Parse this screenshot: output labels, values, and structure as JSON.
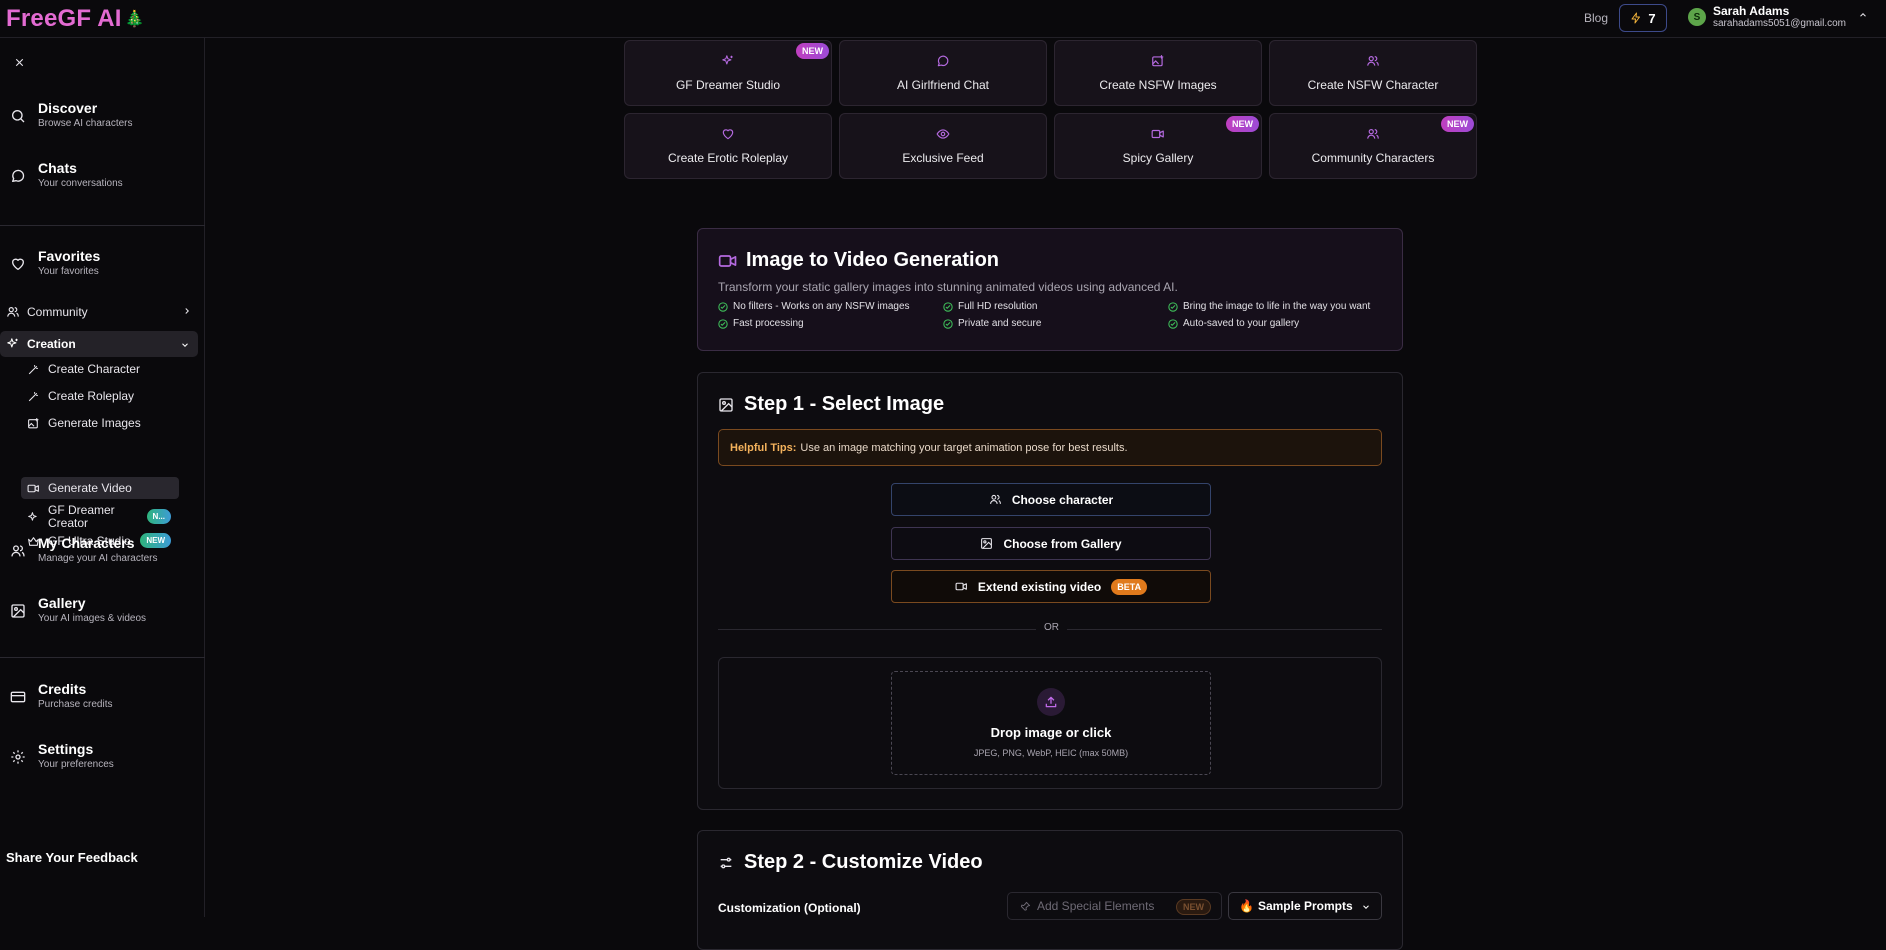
{
  "header": {
    "logo": "FreeGF AI",
    "logo_emoji": "🎄",
    "blog": "Blog",
    "credits": "7",
    "user_initial": "S",
    "user_name": "Sarah Adams",
    "user_email": "sarahadams5051@gmail.com"
  },
  "sidebar": {
    "discover": {
      "title": "Discover",
      "sub": "Browse AI characters"
    },
    "chats": {
      "title": "Chats",
      "sub": "Your conversations"
    },
    "favorites": {
      "title": "Favorites",
      "sub": "Your favorites"
    },
    "community": "Community",
    "creation": "Creation",
    "creation_items": [
      "Create Character",
      "Create Roleplay",
      "Generate Images",
      "Generate Video",
      "GF Dreamer Creator",
      "GF Ultra Studio"
    ],
    "badge_truncated": "N...",
    "badge_new": "NEW",
    "my_characters": {
      "title": "My Characters",
      "sub": "Manage your AI characters"
    },
    "gallery": {
      "title": "Gallery",
      "sub": "Your AI images & videos"
    },
    "credits": {
      "title": "Credits",
      "sub": "Purchase credits"
    },
    "settings": {
      "title": "Settings",
      "sub": "Your preferences"
    },
    "feedback": "Share Your Feedback"
  },
  "quick_links": [
    {
      "label": "GF Dreamer Studio",
      "badge": "NEW",
      "icon": "sparkles-icon"
    },
    {
      "label": "AI Girlfriend Chat",
      "badge": "",
      "icon": "chat-icon"
    },
    {
      "label": "Create NSFW Images",
      "badge": "",
      "icon": "image-plus-icon"
    },
    {
      "label": "Create NSFW Character",
      "badge": "",
      "icon": "users-icon"
    },
    {
      "label": "Create Erotic Roleplay",
      "badge": "",
      "icon": "heart-icon"
    },
    {
      "label": "Exclusive Feed",
      "badge": "",
      "icon": "eye-icon"
    },
    {
      "label": "Spicy Gallery",
      "badge": "NEW",
      "icon": "video-icon"
    },
    {
      "label": "Community Characters",
      "badge": "NEW",
      "icon": "users-icon"
    }
  ],
  "intro": {
    "title": "Image to Video Generation",
    "description": "Transform your static gallery images into stunning animated videos using advanced AI.",
    "features": [
      "No filters - Works on any NSFW images",
      "Full HD resolution",
      "Bring the image to life in the way you want",
      "Fast processing",
      "Private and secure",
      "Auto-saved to your gallery"
    ]
  },
  "step1": {
    "title": "Step 1 - Select Image",
    "tips_label": "Helpful Tips:",
    "tips_text": "Use an image matching your target animation pose for best results.",
    "choose_character": "Choose character",
    "choose_gallery": "Choose from Gallery",
    "extend_video": "Extend existing video",
    "beta": "BETA",
    "or": "OR",
    "drop_title": "Drop image or click",
    "drop_sub": "JPEG, PNG, WebP, HEIC (max 50MB)"
  },
  "step2": {
    "title": "Step 2 - Customize Video",
    "customization_label": "Customization (Optional)",
    "special_elements": "Add Special Elements",
    "special_badge": "NEW",
    "sample_prompts": "Sample Prompts",
    "sample_emoji": "🔥"
  },
  "colors": {
    "accent_pink": "#e36bd2",
    "accent_purple": "#a95de0",
    "check_green": "#3fbf5a",
    "beta_orange": "#e07a1c"
  }
}
